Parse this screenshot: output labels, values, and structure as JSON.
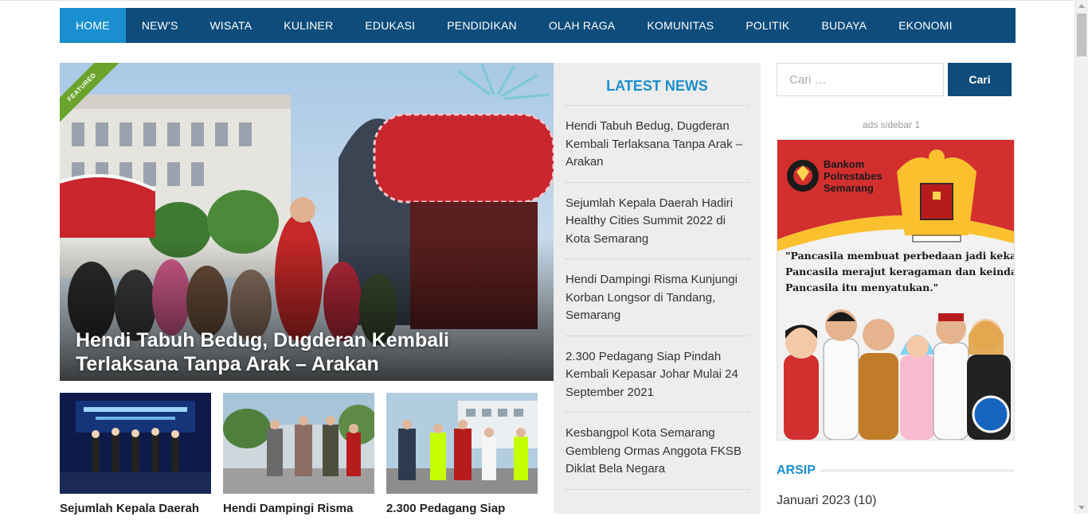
{
  "nav": {
    "items": [
      "HOME",
      "NEW'S",
      "WISATA",
      "KULINER",
      "EDUKASI",
      "PENDIDIKAN",
      "OLAH RAGA",
      "KOMUNITAS",
      "POLITIK",
      "BUDAYA",
      "EKONOMI"
    ],
    "active": "HOME"
  },
  "featured": {
    "badge": "FEATURED",
    "title": "Hendi Tabuh Bedug, Dugderan Kembali Terlaksana Tanpa Arak – Arakan"
  },
  "thumbs": [
    {
      "title": "Sejumlah Kepala Daerah"
    },
    {
      "title": "Hendi Dampingi Risma"
    },
    {
      "title": "2.300 Pedagang Siap"
    }
  ],
  "latest": {
    "title": "LATEST NEWS",
    "items": [
      "Hendi Tabuh Bedug, Dugderan Kembali Terlaksana Tanpa Arak – Arakan",
      "Sejumlah Kepala Daerah Hadiri Healthy Cities Summit 2022 di Kota Semarang",
      "Hendi Dampingi Risma Kunjungi Korban Longsor di Tandang, Semarang",
      "2.300 Pedagang Siap Pindah Kembali Kepasar Johar Mulai 24 September 2021",
      "Kesbangpol Kota Semarang Gembleng Ormas Anggota FKSB Diklat Bela Negara"
    ]
  },
  "sidebar": {
    "search_placeholder": "Cari …",
    "search_button": "Cari",
    "ads_label": "ads sidebar 1",
    "ad": {
      "org_line1": "Bankom",
      "org_line2": "Polrestabes",
      "org_line3": "Semarang",
      "quote_line1": "\"Pancasila membuat perbedaan jadi kekayaan.",
      "quote_line2": "Pancasila merajut keragaman dan keindahan.",
      "quote_line3": "Pancasila itu menyatukan.\""
    },
    "arsip_title": "ARSIP",
    "arsip_items": [
      "Januari 2023 (10)"
    ]
  },
  "colors": {
    "nav_bg": "#0d4c7b",
    "nav_active": "#1a8fd0",
    "accent": "#1a8fd0",
    "featured_badge": "#6ba42c"
  }
}
